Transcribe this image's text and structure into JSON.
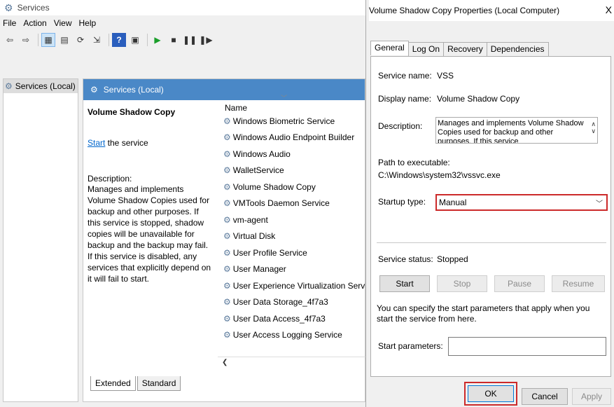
{
  "services_window": {
    "title": "Services",
    "menu": [
      "File",
      "Action",
      "View",
      "Help"
    ],
    "tree_item": "Services (Local)",
    "pane_header": "Services (Local)",
    "selected_service": "Volume Shadow Copy",
    "start_link": "Start",
    "start_suffix": " the service",
    "description_label": "Description:",
    "description": "Manages and implements Volume Shadow Copies used for backup and other purposes. If this service is stopped, shadow copies will be unavailable for backup and the backup may fail. If this service is disabled, any services that explicitly depend on it will fail to start.",
    "column_name": "Name",
    "services": [
      "Windows Biometric Service",
      "Windows Audio Endpoint Builder",
      "Windows Audio",
      "WalletService",
      "Volume Shadow Copy",
      "VMTools Daemon Service",
      "vm-agent",
      "Virtual Disk",
      "User Profile Service",
      "User Manager",
      "User Experience Virtualization Service",
      "User Data Storage_4f7a3",
      "User Data Access_4f7a3",
      "User Access Logging Service"
    ],
    "view_tabs": [
      "Extended",
      "Standard"
    ]
  },
  "dialog": {
    "title": "Volume Shadow Copy Properties (Local Computer)",
    "close": "X",
    "tabs": [
      "General",
      "Log On",
      "Recovery",
      "Dependencies"
    ],
    "service_name_label": "Service name:",
    "service_name": "VSS",
    "display_name_label": "Display name:",
    "display_name": "Volume Shadow Copy",
    "description_label": "Description:",
    "description": "Manages and implements Volume Shadow Copies used for backup and other purposes. If this service",
    "path_label": "Path to executable:",
    "path": "C:\\Windows\\system32\\vssvc.exe",
    "startup_type_label": "Startup type:",
    "startup_type": "Manual",
    "status_label": "Service status:",
    "status": "Stopped",
    "buttons": {
      "start": "Start",
      "stop": "Stop",
      "pause": "Pause",
      "resume": "Resume"
    },
    "params_note": "You can specify the start parameters that apply when you start the service from here.",
    "params_label": "Start parameters:",
    "ok": "OK",
    "cancel": "Cancel",
    "apply": "Apply"
  }
}
